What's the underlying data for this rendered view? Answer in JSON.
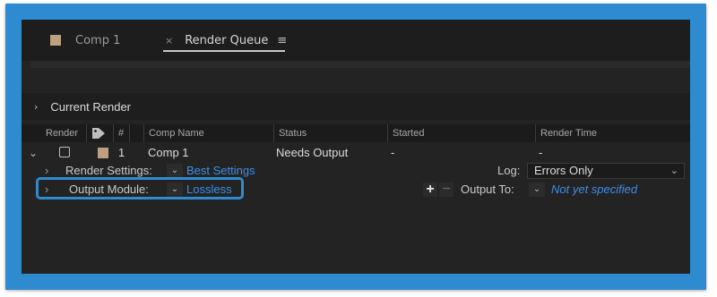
{
  "tabs": {
    "comp_tab_label": "Comp 1",
    "rq_close": "×",
    "rq_label": "Render Queue",
    "rq_menu": "≡"
  },
  "current_render": {
    "chevron": "›",
    "title": "Current Render"
  },
  "columns": {
    "render": "Render",
    "tag_icon": "tag-icon",
    "number": "#",
    "comp_name": "Comp Name",
    "status": "Status",
    "started": "Started",
    "render_time": "Render Time"
  },
  "row": {
    "expander": "⌄",
    "number": "1",
    "comp_name": "Comp 1",
    "status": "Needs Output",
    "started": "-",
    "render_time": "-"
  },
  "render_settings": {
    "expander": "›",
    "label": "Render Settings:",
    "dropdown_arrow": "⌄",
    "value": "Best Settings",
    "log_label": "Log:",
    "log_value": "Errors Only",
    "log_arrow": "⌄"
  },
  "output_module": {
    "expander": "›",
    "label": "Output Module:",
    "dropdown_arrow": "⌄",
    "value": "Lossless",
    "add": "+",
    "remove": "−",
    "output_to_label": "Output To:",
    "output_to_arrow": "⌄",
    "output_to_value": "Not yet specified"
  },
  "colors": {
    "highlight": "#2f8bd0",
    "link": "#3d8ee8",
    "comp_label": "#bba181",
    "panel_bg": "#232323"
  }
}
